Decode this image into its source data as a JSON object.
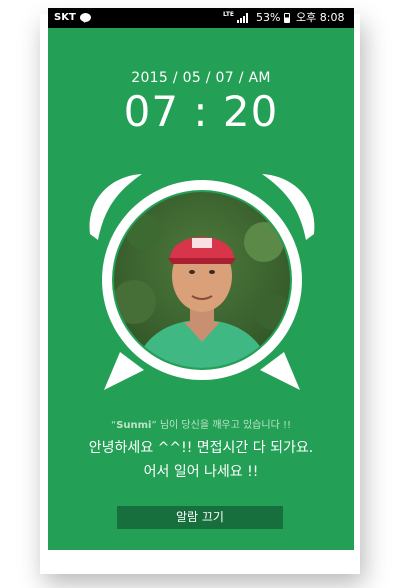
{
  "status_bar": {
    "carrier": "SKT",
    "network": "LTE",
    "battery_percent": "53%",
    "time": "오후 8:08",
    "icons": [
      "kakaotalk-icon",
      "signal-icon",
      "battery-icon"
    ]
  },
  "alarm": {
    "date": "2015 / 05 / 07 / AM",
    "time": "07 : 20"
  },
  "message": {
    "quote": "“",
    "caller": "Sunmi",
    "quote_end": "”",
    "caller_suffix": " 님이 당신을 깨우고 있습니다 !!",
    "line1": "안녕하세요 ^^!! 면접시간 다 되가요.",
    "line2": "어서 일어 나세요 !!"
  },
  "actions": {
    "dismiss_label": "알람 끄기"
  },
  "colors": {
    "background": "#23a055",
    "button": "#186f3e",
    "status_bar": "#000000",
    "text": "#ffffff",
    "caller_text": "#bfe3c8"
  }
}
